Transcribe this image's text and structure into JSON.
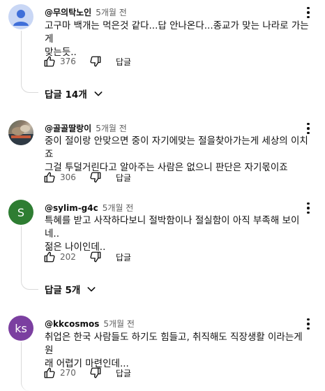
{
  "comments": [
    {
      "author": "@무의탁노인",
      "time": "5개월 전",
      "text": "고구마 백개는 먹은것 같다...답 안나온다...종교가 맞는 나라로 가는게\n맞는듯..",
      "likes": "376",
      "reply_label": "답글",
      "replies": "답글 14개"
    },
    {
      "author": "@골골딸랑이",
      "time": "5개월 전",
      "text": "중이 절이랑 안맞으면 중이 자기에맞는 절을찾아가는게 세상의 이치죠\n그걸 투덜거린다고 알아주는 사람은 없으니 판단은 자기몫이죠",
      "likes": "306",
      "reply_label": "답글"
    },
    {
      "author": "@sylim-g4c",
      "time": "5개월 전",
      "avatar_letter": "S",
      "avatar_color": "#2e7d32",
      "text": "특혜를 받고 사작하다보니 절박함이나 절실함이 아직 부족해 보이네..\n젊은 나이인데..",
      "likes": "202",
      "reply_label": "답글",
      "replies": "답글 5개"
    },
    {
      "author": "@kkcosmos",
      "time": "5개월 전",
      "avatar_letter": "ks",
      "avatar_color": "#7b3fa0",
      "text": "취업은 한국 사람들도 하기도 힘들고, 취직해도 직장생활 이라는게 원\n래 어렵기 마련인데...",
      "likes": "270",
      "reply_label": "답글"
    }
  ]
}
